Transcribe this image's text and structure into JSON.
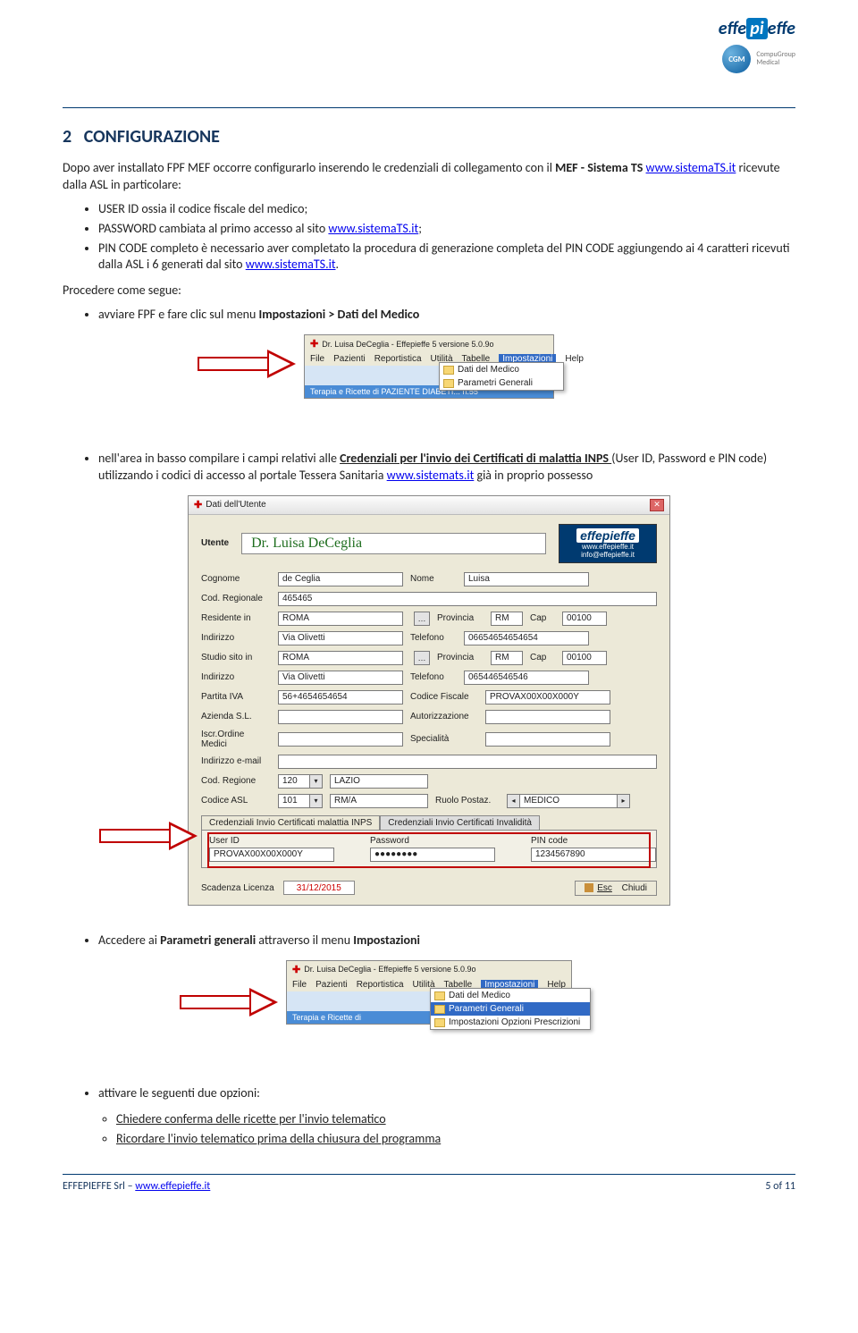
{
  "header": {
    "logo_text_pre": "effe",
    "logo_text_mid": "pi",
    "logo_text_post": "effe",
    "cgm_ball": "CGM",
    "cgm_text1": "CompuGroup",
    "cgm_text2": "Medical"
  },
  "h1_prefix": "2",
  "h1_text": "CONFIGURAZIONE",
  "p1_a": "Dopo aver installato FPF MEF occorre configurarlo inserendo le credenziali di collegamento con il ",
  "p1_b": "MEF - Sistema TS ",
  "p1_link": "www.sistemaTS.it",
  "p1_c": " ricevute dalla ASL in particolare:",
  "bullets1": {
    "b1": "USER ID ossia il codice fiscale del medico;",
    "b2_a": "PASSWORD cambiata al primo accesso al sito ",
    "b2_link": "www.sistemaTS.it",
    "b2_b": ";",
    "b3_a": "PIN CODE completo è necessario aver completato la procedura di generazione completa del PIN CODE  aggiungendo ai 4 caratteri ricevuti dalla ASL i 6 generati dal sito ",
    "b3_link": "www.sistemaTS.it",
    "b3_b": "."
  },
  "p2": "Procedere come segue:",
  "bullets2": {
    "b1_a": "avviare FPF e fare clic sul menu ",
    "b1_b": "Impostazioni > Dati del Medico"
  },
  "screenshot1": {
    "title": "Dr. Luisa DeCeglia - Effepieffe 5 versione 5.0.9o",
    "menu": [
      "File",
      "Pazienti",
      "Reportistica",
      "Utilità",
      "Tabelle",
      "Impostazioni",
      "Help"
    ],
    "dropdown": [
      "Dati del Medico",
      "Parametri Generali"
    ],
    "blueband": "Terapia e Ricette di PAZIENTE DIABETI... n.55"
  },
  "bullets3": {
    "b1_a": "nell'area in basso compilare i campi relativi alle ",
    "b1_u": "Credenziali per l'invio dei Certificati di malattia INPS ",
    "b1_b": "(User ID, Password e PIN code) utilizzando i codici di accesso al portale Tessera Sanitaria ",
    "b1_link": "www.sistemats.it",
    "b1_c": " già in proprio possesso"
  },
  "screenshot2": {
    "title": "Dati dell'Utente",
    "utente_label": "Utente",
    "utente_name": "Dr. Luisa DeCeglia",
    "logo_line1": "effepieffe",
    "logo_line2": "www.effepieffe.it",
    "logo_line3": "info@effepieffe.it",
    "labels": {
      "cognome": "Cognome",
      "nome": "Nome",
      "codreg": "Cod. Regionale",
      "residente": "Residente in",
      "provincia": "Provincia",
      "cap": "Cap",
      "indirizzo": "Indirizzo",
      "telefono": "Telefono",
      "studio": "Studio sito in",
      "piva": "Partita IVA",
      "codfisc": "Codice Fiscale",
      "azienda": "Azienda S.L.",
      "autorizz": "Autorizzazione",
      "ordine": "Iscr.Ordine Medici",
      "specialita": "Specialità",
      "email": "Indirizzo e-mail",
      "codregione": "Cod. Regione",
      "codasl": "Codice ASL",
      "ruolo": "Ruolo Postaz.",
      "tab1": "Credenziali Invio Certificati malattia INPS",
      "tab2": "Credenziali Invio Certificati Invalidità",
      "userid": "User ID",
      "password": "Password",
      "pincode": "PIN code",
      "scadenza": "Scadenza Licenza",
      "chiudi": "Chiudi",
      "esc": "Esc"
    },
    "values": {
      "cognome": "de Ceglia",
      "nome": "Luisa",
      "codreg": "465465",
      "residente": "ROMA",
      "prov": "RM",
      "cap": "00100",
      "indirizzo": "Via Olivetti",
      "tel1": "06654654654654",
      "studio": "ROMA",
      "indirizzo2": "Via Olivetti",
      "tel2": "065446546546",
      "piva": "56+4654654654",
      "codfisc": "PROVAX00X00X000Y",
      "codregione": "120",
      "regione": "LAZIO",
      "codasl": "101",
      "asl": "RM/A",
      "ruolo": "MEDICO",
      "userid": "PROVAX00X00X000Y",
      "password": "●●●●●●●●",
      "pincode": "1234567890",
      "scadenza": "31/12/2015"
    }
  },
  "bullets4": {
    "b1_a": "Accedere ai ",
    "b1_b": "Parametri generali",
    "b1_c": " attraverso il menu ",
    "b1_d": "Impostazioni"
  },
  "screenshot3": {
    "title": "Dr. Luisa DeCeglia - Effepieffe 5 versione 5.0.9o",
    "menu": [
      "File",
      "Pazienti",
      "Reportistica",
      "Utilità",
      "Tabelle",
      "Impostazioni",
      "Help"
    ],
    "dropdown": [
      "Dati del Medico",
      "Parametri Generali",
      "Impostazioni Opzioni Prescrizioni"
    ],
    "blueband": "Terapia e Ricette di"
  },
  "bullets5": {
    "b1": "attivare le seguenti due opzioni:",
    "sub1": "Chiedere conferma delle ricette per l'invio telematico",
    "sub2": "Ricordare l'invio telematico prima della chiusura del programma"
  },
  "footer": {
    "left_a": "EFFEPIEFFE Srl – ",
    "left_link": "www.effepieffe.it",
    "right": "5 of 11"
  }
}
